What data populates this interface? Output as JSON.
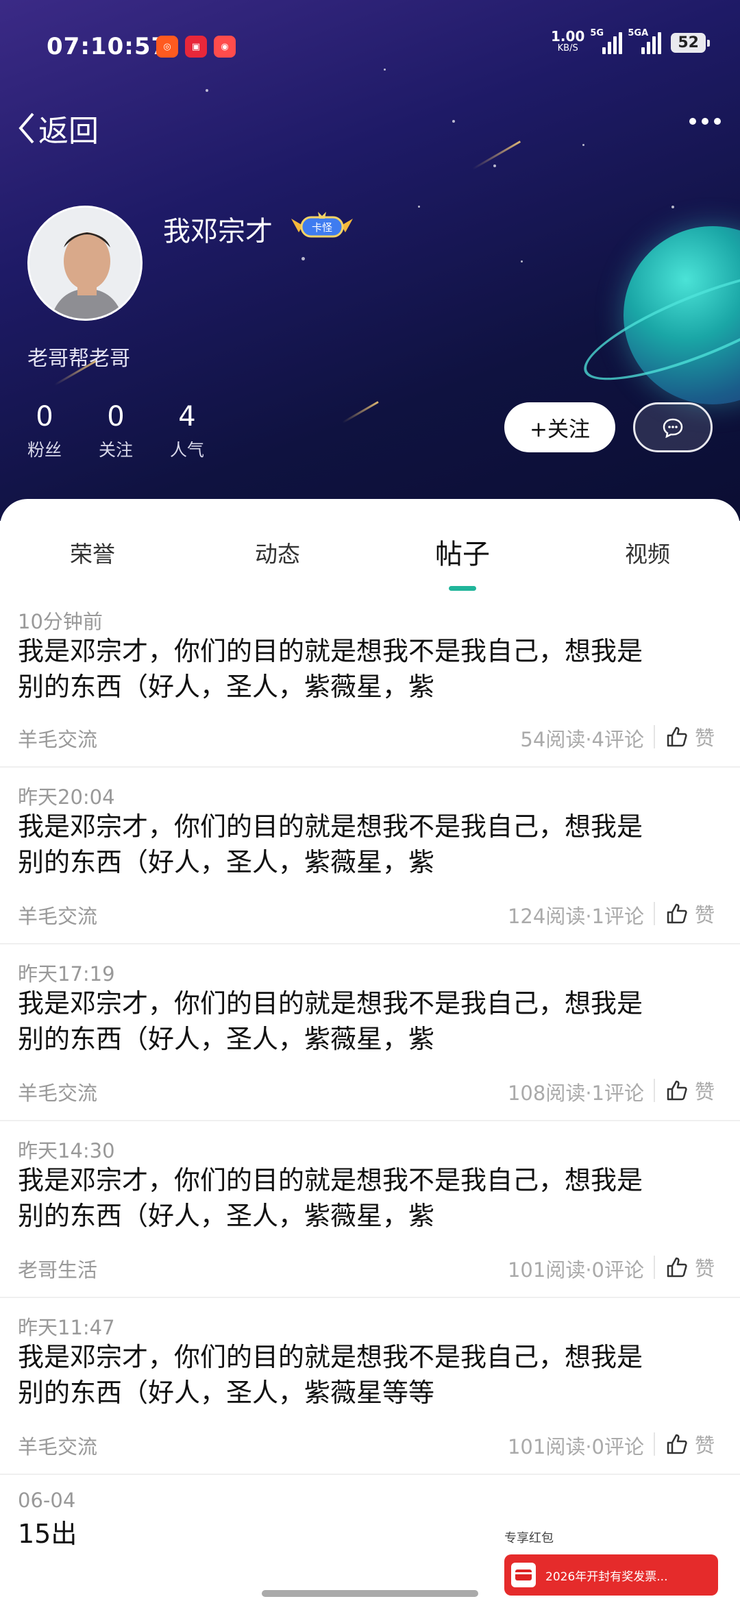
{
  "status_bar": {
    "time": "07:10:57",
    "net_speed": "1.00",
    "net_unit": "KB/S",
    "sig1_label": "5G",
    "sig2_label": "5GA",
    "battery": "52"
  },
  "nav": {
    "back_label": "返回"
  },
  "profile": {
    "name": "我邓宗才",
    "badge_text": "卡怪",
    "bio": "老哥帮老哥",
    "stats": [
      {
        "num": "0",
        "label": "粉丝"
      },
      {
        "num": "0",
        "label": "关注"
      },
      {
        "num": "4",
        "label": "人气"
      }
    ],
    "follow_label": "+关注"
  },
  "tabs": [
    {
      "label": "荣誉"
    },
    {
      "label": "动态"
    },
    {
      "label": "帖子",
      "active": true
    },
    {
      "label": "视频"
    }
  ],
  "posts": [
    {
      "time": "10分钟前",
      "line1": "我是邓宗才，你们的目的就是想我不是我自己，想我是",
      "line2": "别的东西（好人，圣人，紫薇星，紫",
      "category": "羊毛交流",
      "meta": "54阅读·4评论",
      "like": "赞"
    },
    {
      "time": "昨天20:04",
      "line1": "我是邓宗才，你们的目的就是想我不是我自己，想我是",
      "line2": "别的东西（好人，圣人，紫薇星，紫",
      "category": "羊毛交流",
      "meta": "124阅读·1评论",
      "like": "赞"
    },
    {
      "time": "昨天17:19",
      "line1": "我是邓宗才，你们的目的就是想我不是我自己，想我是",
      "line2": "别的东西（好人，圣人，紫薇星，紫",
      "category": "羊毛交流",
      "meta": "108阅读·1评论",
      "like": "赞"
    },
    {
      "time": "昨天14:30",
      "line1": "我是邓宗才，你们的目的就是想我不是我自己，想我是",
      "line2": "别的东西（好人，圣人，紫薇星，紫",
      "category": "老哥生活",
      "meta": "101阅读·0评论",
      "like": "赞"
    },
    {
      "time": "昨天11:47",
      "line1": "我是邓宗才，你们的目的就是想我不是我自己，想我是",
      "line2": "别的东西（好人，圣人，紫薇星等等",
      "category": "羊毛交流",
      "meta": "101阅读·0评论",
      "like": "赞"
    },
    {
      "time": "06-04",
      "line1": "15出",
      "line2": ""
    }
  ],
  "red_packet": {
    "label": "专享红包",
    "text": "2026年开封有奖发票..."
  }
}
